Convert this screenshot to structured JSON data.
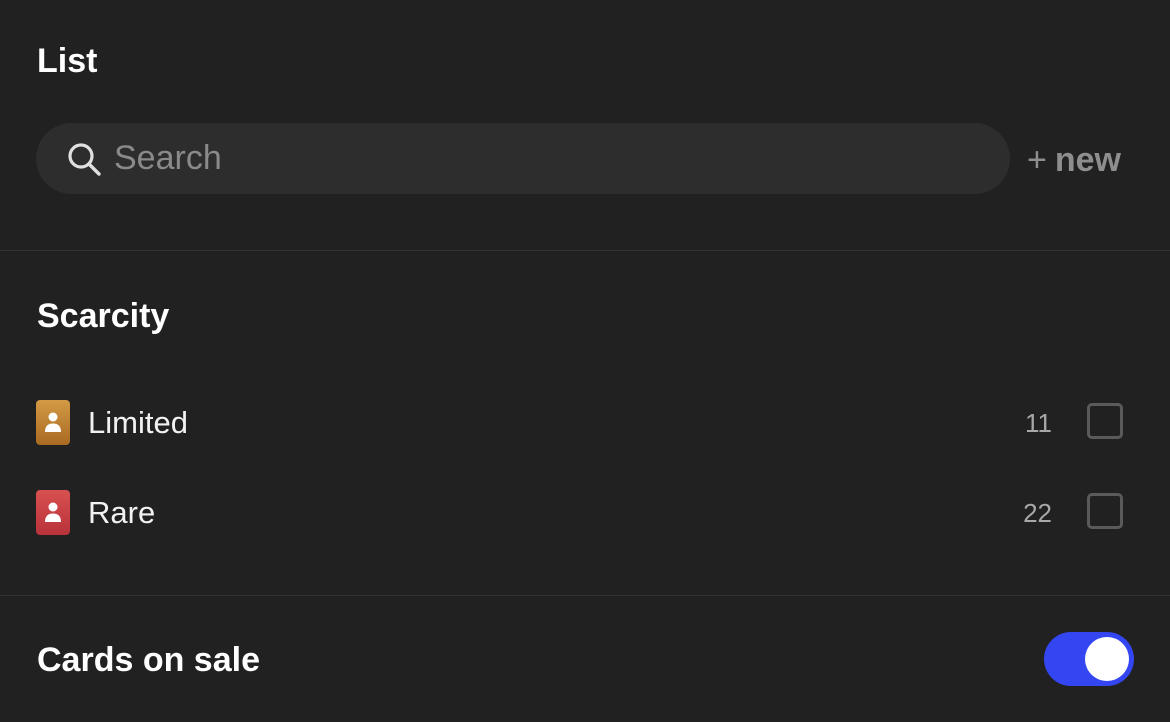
{
  "header": {
    "title": "List"
  },
  "search": {
    "placeholder": "Search",
    "value": "",
    "icon": "search-icon"
  },
  "new_button": {
    "plus": "+",
    "label": "new"
  },
  "scarcity": {
    "title": "Scarcity",
    "items": [
      {
        "label": "Limited",
        "count": "11",
        "checked": false,
        "badge_color": "#c0832f",
        "icon": "person-icon"
      },
      {
        "label": "Rare",
        "count": "22",
        "checked": false,
        "badge_color": "#cc3f46",
        "icon": "person-icon"
      }
    ]
  },
  "cards_on_sale": {
    "title": "Cards on sale",
    "enabled": true,
    "toggle_color": "#3446f2"
  }
}
